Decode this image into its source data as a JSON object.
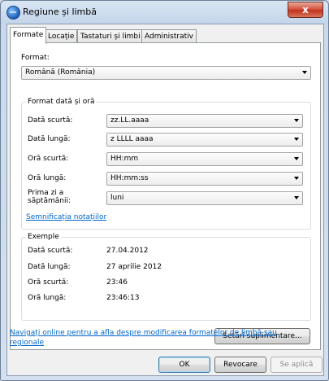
{
  "window": {
    "title": "Regiune și limbă",
    "close_label": "x"
  },
  "tabs": [
    {
      "label": "Formate"
    },
    {
      "label": "Locație"
    },
    {
      "label": "Tastaturi și limbi"
    },
    {
      "label": "Administrativ"
    }
  ],
  "format": {
    "label": "Format:",
    "value": "Română (România)"
  },
  "date_time_group": {
    "title": "Format dată și oră",
    "rows": [
      {
        "label": "Dată scurtă:",
        "value": "zz.LL.aaaa"
      },
      {
        "label": "Dată lungă:",
        "value": "z LLLL aaaa"
      },
      {
        "label": "Oră scurtă:",
        "value": "HH:mm"
      },
      {
        "label": "Oră lungă:",
        "value": "HH:mm:ss"
      },
      {
        "label": "Prima zi a săptămânii:",
        "label_line1": "Prima zi a",
        "label_line2": "săptămânii:",
        "value": "luni"
      }
    ],
    "notation_link": "Semnificația notațiilor"
  },
  "examples": {
    "title": "Exemple",
    "rows": [
      {
        "label": "Dată scurtă:",
        "value": "27.04.2012"
      },
      {
        "label": "Dată lungă:",
        "value": "27 aprilie 2012"
      },
      {
        "label": "Oră scurtă:",
        "value": "23:46"
      },
      {
        "label": "Oră lungă:",
        "value": "23:46:13"
      }
    ]
  },
  "additional_settings_button": "Setări suplimentare...",
  "online_link": "Navigați online pentru a afla despre modificarea formatelor de limbă sau regionale",
  "online_link_line1": "Navigați online pentru a afla despre modificarea formatelor de limbă sau",
  "online_link_line2": "regionale",
  "buttons": {
    "ok": "OK",
    "cancel": "Revocare",
    "apply": "Se aplică"
  }
}
